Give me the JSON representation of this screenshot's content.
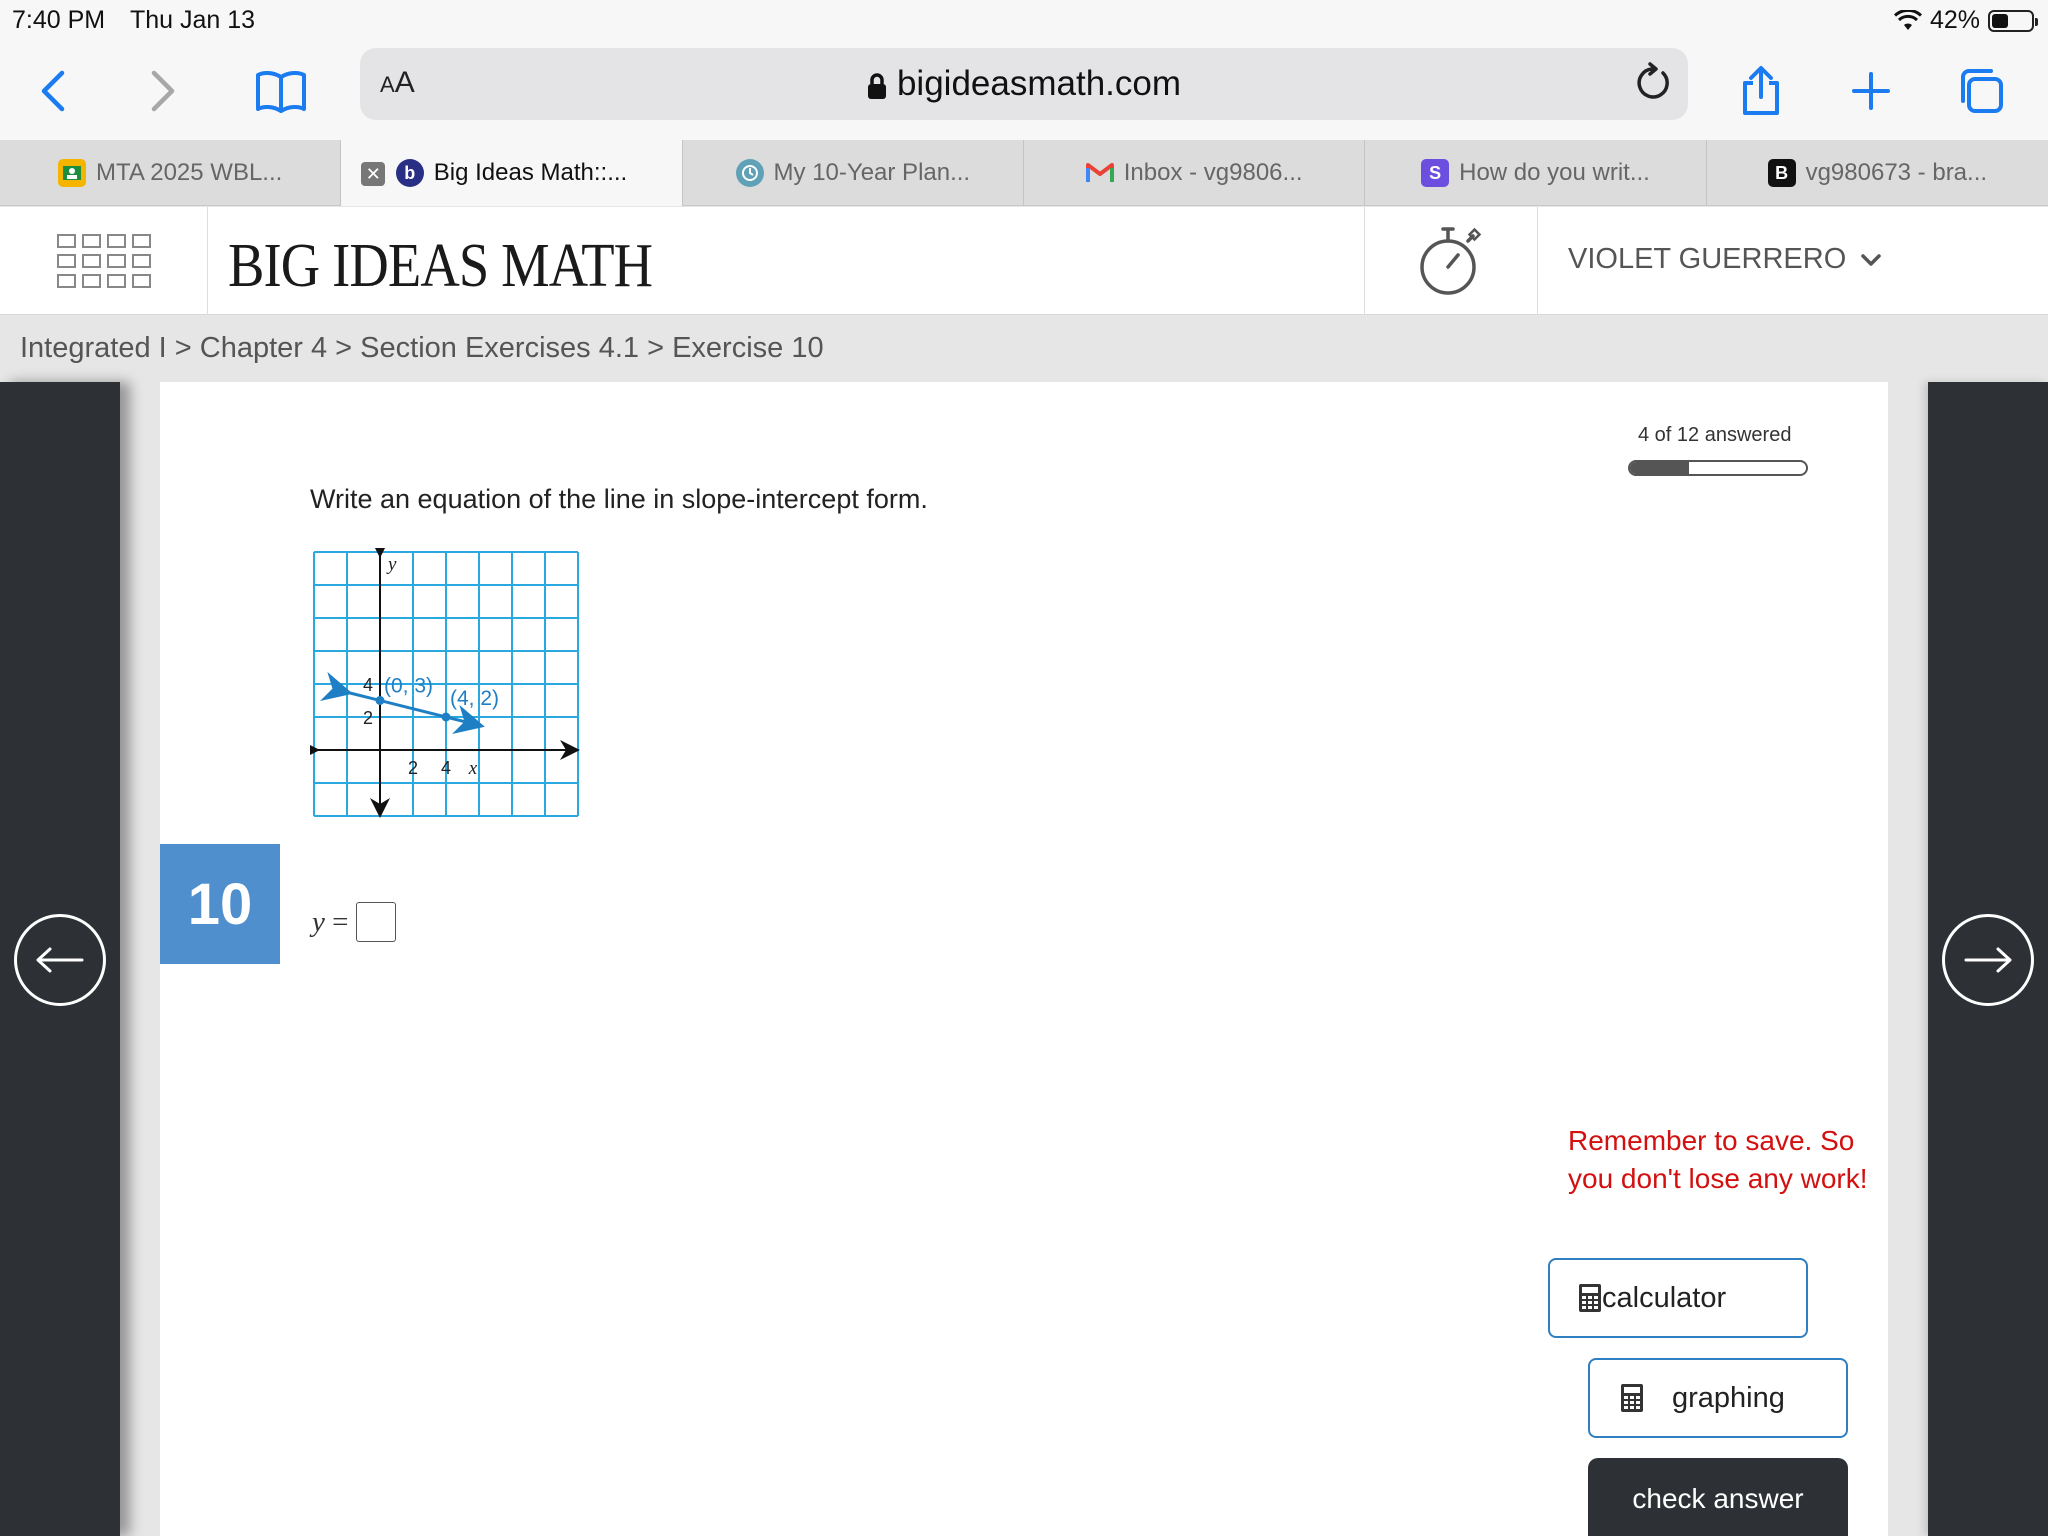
{
  "status_bar": {
    "time": "7:40 PM",
    "date": "Thu Jan 13",
    "battery_text": "42%",
    "battery_level": 0.42
  },
  "browser": {
    "url": "bigideasmath.com",
    "text_size_label_small": "A",
    "text_size_label_large": "A",
    "tabs": [
      {
        "label": "MTA 2025 WBL...",
        "icon": "google-classroom-icon",
        "active": false
      },
      {
        "label": "Big Ideas Math::...",
        "icon": "big-ideas-math-icon",
        "active": true
      },
      {
        "label": "My 10-Year Plan...",
        "icon": "planner-icon",
        "active": false
      },
      {
        "label": "Inbox - vg9806...",
        "icon": "gmail-icon",
        "active": false
      },
      {
        "label": "How do you writ...",
        "icon": "socratic-icon",
        "active": false
      },
      {
        "label": "vg980673 - bra...",
        "icon": "brainly-icon",
        "active": false
      }
    ],
    "tab_fav_letters": {
      "big_ideas": "b",
      "socratic": "S",
      "brainly": "B"
    }
  },
  "header": {
    "logo": "BIG IDEAS MATH",
    "user_name": "VIOLET GUERRERO"
  },
  "breadcrumb": "Integrated I > Chapter 4 > Section Exercises 4.1 > Exercise 10",
  "exercise": {
    "number": "10",
    "progress_text": "4 of 12 answered",
    "progress_fraction": 0.333,
    "question": "Write an equation of the line in slope-intercept form.",
    "answer_prefix_var": "y",
    "answer_prefix_eq": "=",
    "answer_value": ""
  },
  "graph": {
    "x_axis_label": "x",
    "y_axis_label": "y",
    "x_tick_labels": [
      "2",
      "4"
    ],
    "y_tick_labels": [
      "2",
      "4"
    ],
    "point_a_label": "(0, 3)",
    "point_b_label": "(4, 2)",
    "points": [
      {
        "x": 0,
        "y": 3
      },
      {
        "x": 4,
        "y": 2
      }
    ],
    "line_color": "#1f7fc4",
    "grid_color": "#2aa9e0"
  },
  "reminder": "Remember to save. So you don't lose any work!",
  "buttons": {
    "calculator": "calculator",
    "graphing": "graphing",
    "check_answer": "check answer"
  },
  "colors": {
    "exercise_badge": "#4f8fcd",
    "reminder": "#d31010",
    "dark_panel": "#2d3135",
    "accent": "#2f7fc1"
  }
}
